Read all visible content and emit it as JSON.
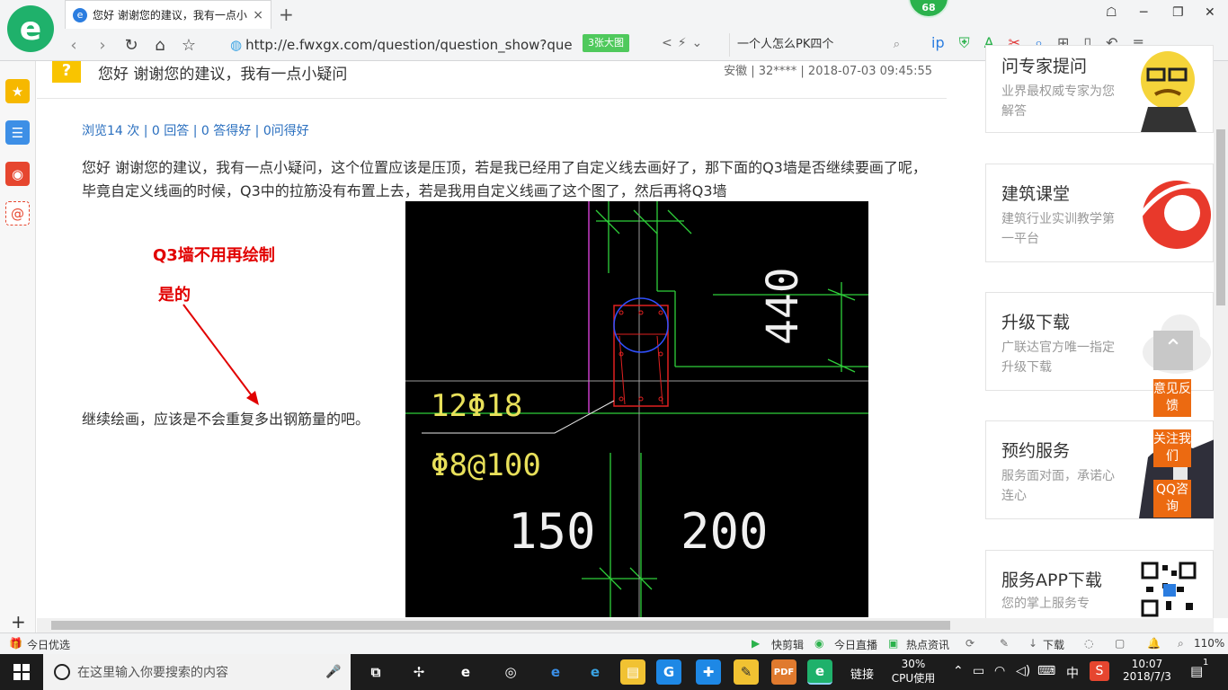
{
  "browser": {
    "tab_title": "您好 谢谢您的建议，我有一点小疑问",
    "tab_close": "×",
    "new_tab": "+",
    "badge": "68",
    "url": "http://e.fwxgx.com/question/question_show?que",
    "image_button": "3张大图",
    "search_text": "一个人怎么PK四个",
    "window_controls": [
      "minimize",
      "maximize",
      "close"
    ]
  },
  "question": {
    "icon": "?",
    "title": "您好 谢谢您的建议，我有一点小疑问",
    "meta": "安徽 | 32**** | 2018-07-03 09:45:55",
    "stats": "浏览14 次 | 0 回答 | 0 答得好 | 0问得好",
    "body_1": "您好 谢谢您的建议，我有一点小疑问，这个位置应该是压顶，若是我已经用了自定义线去画好了，那下面的Q3墙是否继续要画了呢，毕竟自定义线画的时候，Q3中的拉筋没有布置上去，若是我用自定义线画了这个图了，然后再将Q3墙",
    "body_2": "继续绘画，应该是不会重复多出钢筋量的吧。"
  },
  "annotation": {
    "line1": "Q3墙不用再绘制",
    "line2": "是的",
    "color": "#e10000"
  },
  "drawing": {
    "rebar_main": "12Φ18",
    "rebar_stirrup": "Φ8@100",
    "dim_left": "150",
    "dim_right": "200",
    "dim_vertical": "440"
  },
  "sidebar": {
    "cards": [
      {
        "title": "问专家提问",
        "sub": "业界最权威专家为您解答"
      },
      {
        "title": "建筑课堂",
        "sub": "建筑行业实训教学第一平台"
      },
      {
        "title": "升级下载",
        "sub": "广联达官方唯一指定升级下载"
      },
      {
        "title": "预约服务",
        "sub": "服务面对面，承诺心连心"
      },
      {
        "title": "服务APP下载",
        "sub": "您的掌上服务专"
      }
    ],
    "float_buttons": [
      "意见反馈",
      "关注我们",
      "QQ咨询"
    ]
  },
  "statusbar": {
    "left": "今日优选",
    "items": [
      "快剪辑",
      "今日直播",
      "热点资讯",
      "下载"
    ],
    "zoom": "110%"
  },
  "taskbar": {
    "search_placeholder": "在这里输入你要搜索的内容",
    "link_label": "链接",
    "cpu_pct": "30%",
    "cpu_label": "CPU使用",
    "ime": "中",
    "time": "10:07",
    "date": "2018/7/3",
    "notifications": "1"
  },
  "colors": {
    "accent_green": "#1fb16b",
    "link_blue": "#2a6fbf",
    "float_orange": "#ec6a11"
  }
}
